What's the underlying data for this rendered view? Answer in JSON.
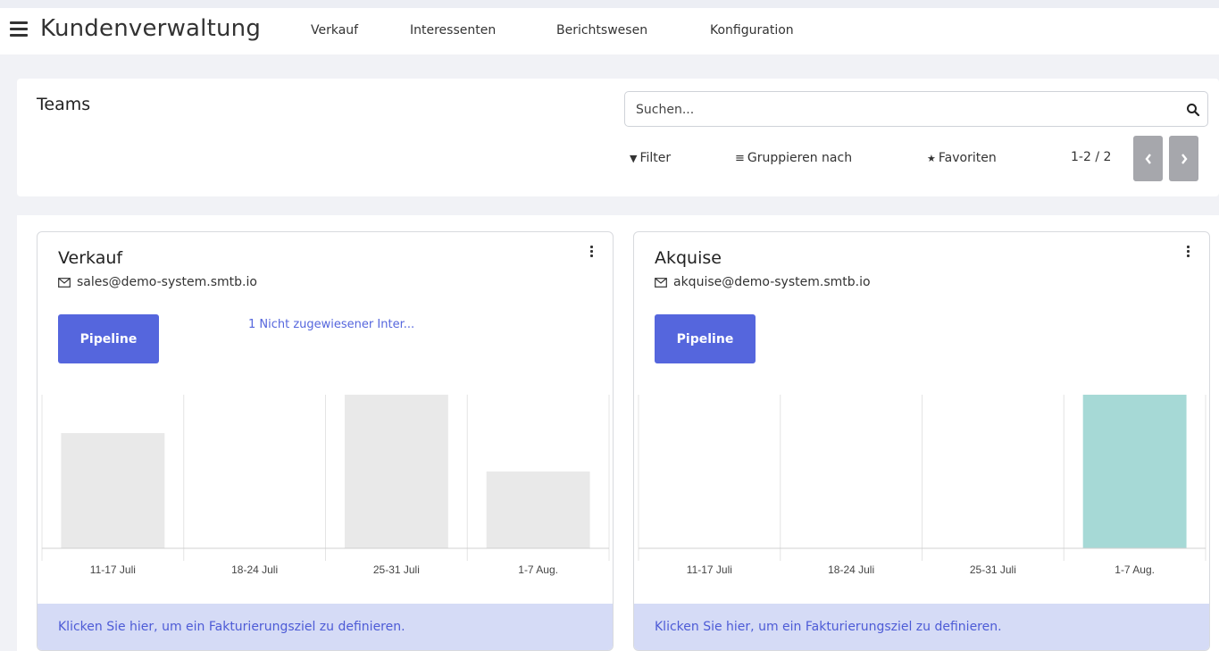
{
  "header": {
    "app_title": "Kundenverwaltung",
    "nav": [
      "Verkauf",
      "Interessenten",
      "Berichtswesen",
      "Konfiguration"
    ]
  },
  "control_panel": {
    "title": "Teams",
    "search": {
      "placeholder": "Suchen..."
    },
    "filter_label": "Filter",
    "group_by_label": "Gruppieren nach",
    "favorites_label": "Favoriten",
    "pager_value": "1-2 / 2"
  },
  "cards": [
    {
      "title": "Verkauf",
      "email": "sales@demo-system.smtb.io",
      "pipeline_label": "Pipeline",
      "link_text": "1 Nicht zugewiesener Inter...",
      "footer_text": "Klicken Sie hier, um ein Fakturierungsziel zu definieren."
    },
    {
      "title": "Akquise",
      "email": "akquise@demo-system.smtb.io",
      "pipeline_label": "Pipeline",
      "link_text": "",
      "footer_text": "Klicken Sie hier, um ein Fakturierungsziel zu definieren."
    }
  ],
  "chart_data": [
    {
      "type": "bar",
      "categories": [
        "11-17 Juli",
        "18-24 Juli",
        "25-31 Juli",
        "1-7 Aug."
      ],
      "values": [
        0.75,
        0,
        1.0,
        0.5
      ],
      "bar_color": "#e9e9e9",
      "ylim": [
        0,
        1
      ]
    },
    {
      "type": "bar",
      "categories": [
        "11-17 Juli",
        "18-24 Juli",
        "25-31 Juli",
        "1-7 Aug."
      ],
      "values": [
        0,
        0,
        0,
        1.0
      ],
      "bar_color": "#a6d9d6",
      "ylim": [
        0,
        1
      ]
    }
  ]
}
